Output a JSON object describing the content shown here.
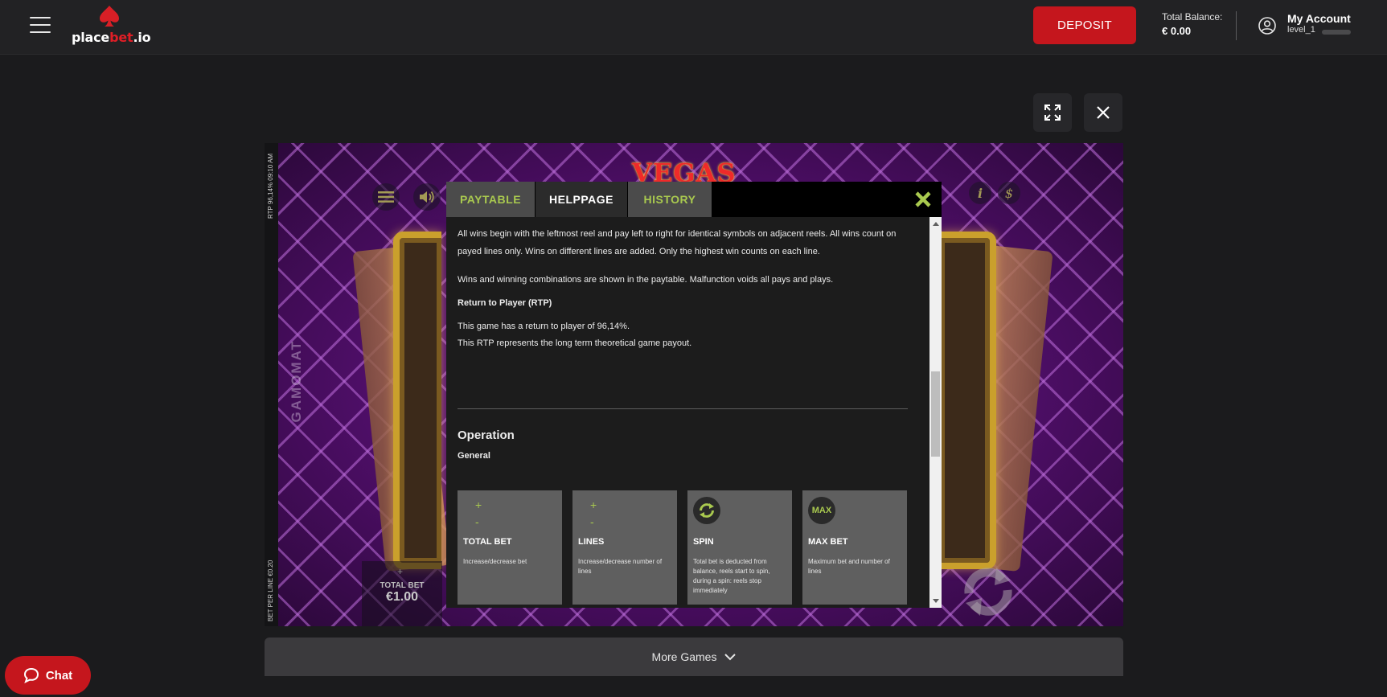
{
  "header": {
    "logo": {
      "part1": "place",
      "part2": "bet",
      "part3": ".io"
    },
    "deposit_label": "DEPOSIT",
    "balance_label": "Total Balance:",
    "balance_value": "€ 0.00",
    "account_name": "My Account",
    "account_level": "level_1"
  },
  "game": {
    "rtp_vertical": "RTP 96,14% 09:10 AM",
    "bet_per_line_vertical": "BET PER LINE €0.20",
    "provider": "GAMOMAT",
    "logo_text": "VEGAS",
    "total_bet_label": "TOTAL BET",
    "total_bet_value": "€1.00",
    "plus": "+",
    "info": "i",
    "dollar": "$"
  },
  "modal": {
    "tabs": {
      "paytable": "PAYTABLE",
      "helppage": "HELPPAGE",
      "history": "HISTORY"
    },
    "active_tab": "HELPPAGE",
    "para1": "All wins begin with the leftmost reel and pay left to right for identical symbols on adjacent reels. All wins count on payed lines only. Wins on different lines are added. Only the highest win counts on each line.",
    "para2": "Wins and winning combinations are shown in the paytable. Malfunction voids all pays and plays.",
    "rtp_heading": "Return to Player (RTP)",
    "rtp_line1": "This game has a return to player of 96,14%.",
    "rtp_line2": "This RTP represents the long term theoretical game payout.",
    "operation_heading": "Operation",
    "general_heading": "General",
    "cards": [
      {
        "title": "TOTAL BET",
        "desc": "Increase/decrease bet",
        "plus": "+",
        "minus": "-"
      },
      {
        "title": "LINES",
        "desc": "Increase/decrease number of lines",
        "plus": "+",
        "minus": "-"
      },
      {
        "title": "SPIN",
        "desc": "Total bet is deducted from balance, reels start to spin, during a spin: reels stop immediately"
      },
      {
        "title": "MAX BET",
        "desc": "Maximum bet and number of lines",
        "icon_text": "MAX"
      }
    ]
  },
  "more_games_label": "More Games",
  "chat_label": "Chat",
  "colors": {
    "accent_red": "#c5161d",
    "accent_green": "#a9c94f"
  }
}
